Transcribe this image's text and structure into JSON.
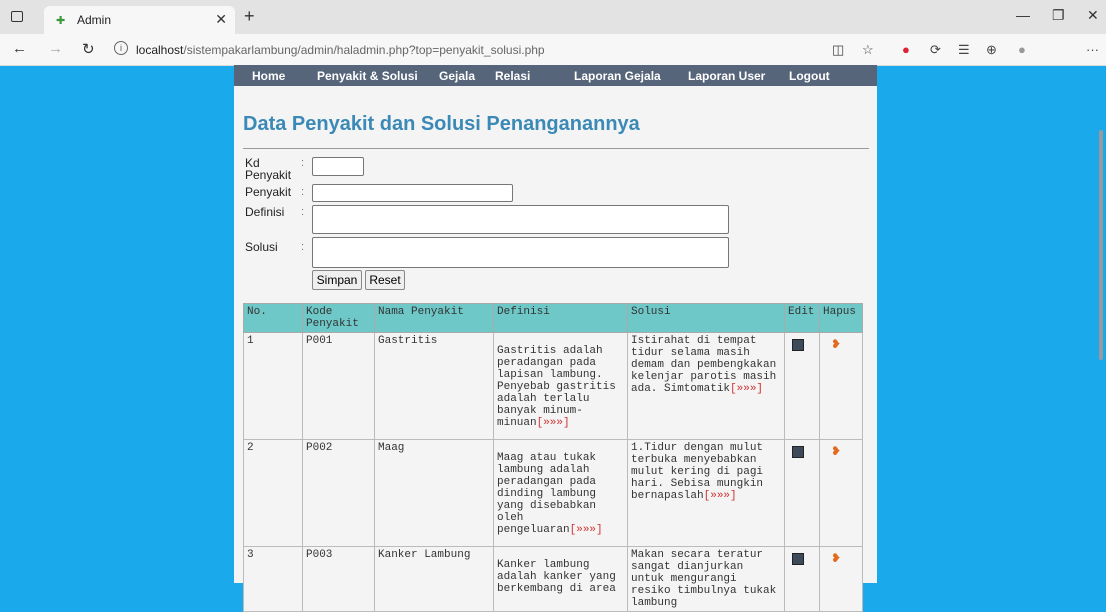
{
  "browser": {
    "tab_title": "Admin",
    "url_host": "localhost",
    "url_path": "/sistempakarlambung/admin/haladmin.php?top=penyakit_solusi.php"
  },
  "menu": [
    "Home",
    "Penyakit & Solusi",
    "Gejala",
    "Relasi",
    "Laporan Gejala",
    "Laporan User",
    "Logout"
  ],
  "page_title": "Data Penyakit dan Solusi Penanganannya",
  "form": {
    "kd_label": "Kd Penyakit",
    "penyakit_label": "Penyakit",
    "definisi_label": "Definisi",
    "solusi_label": "Solusi",
    "simpan": "Simpan",
    "reset": "Reset"
  },
  "table": {
    "headers": [
      "No.",
      "Kode Penyakit",
      "Nama Penyakit",
      "Definisi",
      "Solusi",
      "Edit",
      "Hapus"
    ],
    "rows": [
      {
        "no": "1",
        "kode": "P001",
        "nama": "Gastritis",
        "definisi": "Gastritis adalah peradangan pada lapisan lambung. Penyebab gastritis adalah terlalu banyak minum-minuan",
        "solusi": "Istirahat di tempat tidur selama masih demam dan pembengkakan kelenjar parotis masih ada. Simtomatik"
      },
      {
        "no": "2",
        "kode": "P002",
        "nama": "Maag",
        "definisi": "Maag atau tukak lambung adalah peradangan pada dinding lambung yang disebabkan oleh pengeluaran",
        "solusi": "1.Tidur dengan mulut terbuka menyebabkan mulut kering di pagi hari. Sebisa mungkin bernapaslah"
      },
      {
        "no": "3",
        "kode": "P003",
        "nama": "Kanker Lambung",
        "definisi": "Kanker lambung adalah kanker yang berkembang di area",
        "solusi": "Makan secara teratur sangat dianjurkan untuk mengurangi resiko timbulnya tukak lambung"
      }
    ],
    "more_link": "[»»»]"
  }
}
